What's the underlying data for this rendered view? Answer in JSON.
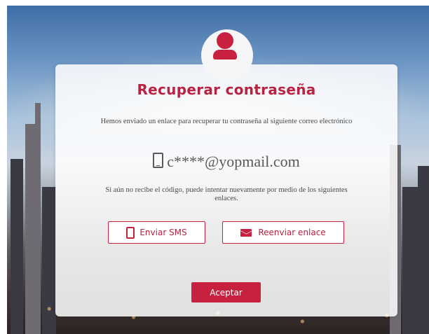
{
  "theme": {
    "accent": "#c8203f",
    "title_color": "#b82342",
    "text_color": "#4a4a4a"
  },
  "header": {
    "icon": "user-icon",
    "title": "Recuperar contraseña"
  },
  "message": {
    "description": "Hemos enviado un enlace para recuperar tu contraseña al siguiente correo electrónico",
    "email_icon": "phone-icon",
    "email": "c****@yopmail.com",
    "retry_text": "Si aún no recibe el código, puede intentar nuevamente por medio de los siguientes enlaces."
  },
  "actions": {
    "sms_icon": "mobile-icon",
    "sms_label": "Enviar SMS",
    "resend_icon": "envelope-icon",
    "resend_label": "Reenviar enlace",
    "accept_label": "Aceptar"
  }
}
